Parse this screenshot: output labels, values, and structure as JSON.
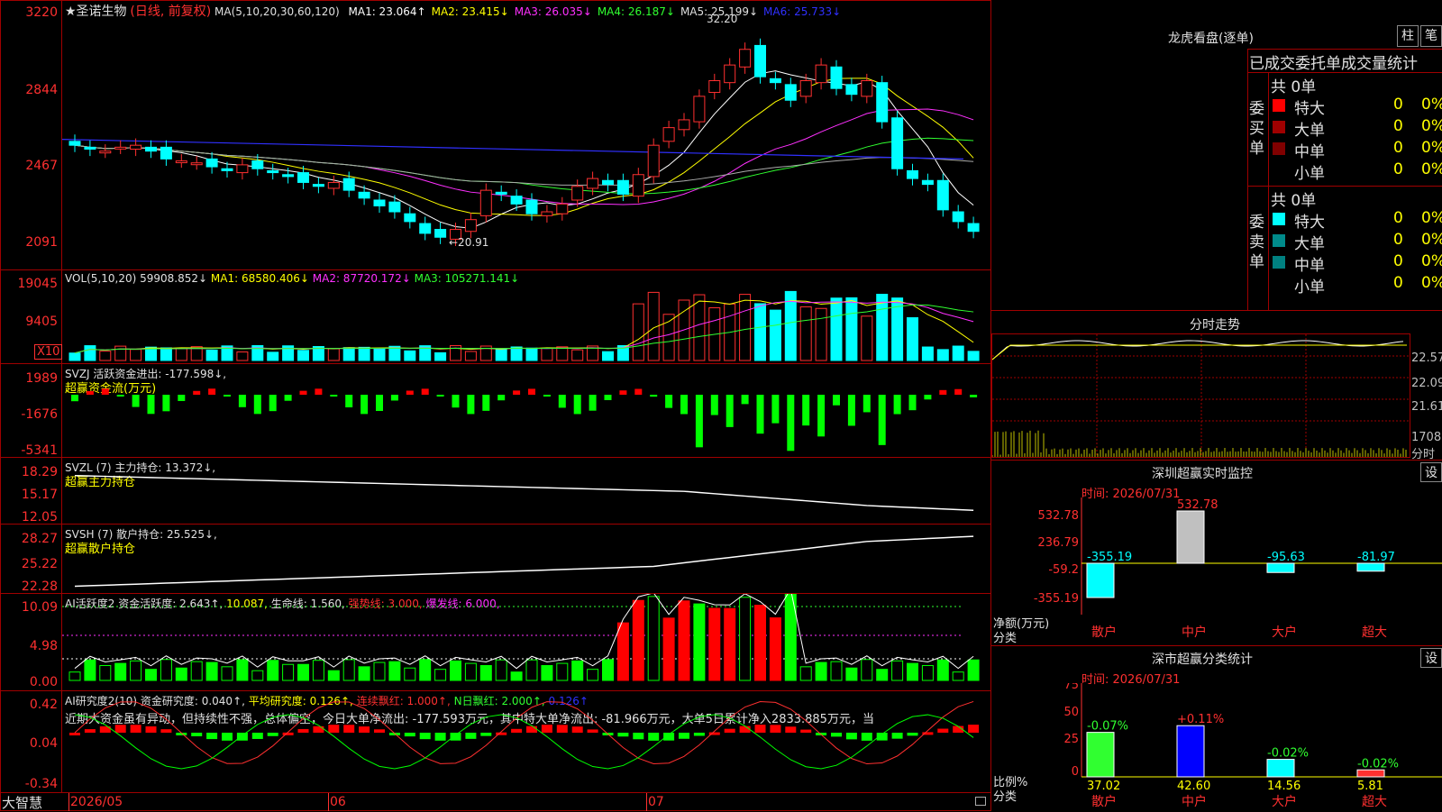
{
  "stock": {
    "name": "★圣诺生物",
    "mode": "(日线, 前复权)",
    "ma_title": "MA(5,10,20,30,60,120)"
  },
  "ma_values": [
    {
      "label": "MA1:",
      "value": "23.064↑",
      "color": "#ffffff"
    },
    {
      "label": "MA2:",
      "value": "23.415↓",
      "color": "#ffff00"
    },
    {
      "label": "MA3:",
      "value": "26.035↓",
      "color": "#ff30ff"
    },
    {
      "label": "MA4:",
      "value": "26.187↓",
      "color": "#30ff30"
    },
    {
      "label": "MA5:",
      "value": "25.199↓",
      "color": "#e0e0e0"
    },
    {
      "label": "MA6:",
      "value": "25.733↓",
      "color": "#3030ff"
    }
  ],
  "price_axis": [
    "3220",
    "2844",
    "2467",
    "2091"
  ],
  "high_marker": "32.20",
  "low_marker": "←20.91",
  "vol": {
    "title": "VOL(5,10,20)",
    "value": "59908.852↓",
    "ma1": "MA1: 68580.406↓",
    "ma2": "MA2: 87720.172↓",
    "ma3": "MA3: 105271.141↓",
    "axis": [
      "19045",
      "9405"
    ],
    "unit": "X10"
  },
  "svzj": {
    "title": "SVZJ",
    "text": "活跃资金进出: -177.598↓,",
    "sub": "超赢资金流(万元)",
    "axis": [
      "1989",
      "-1676",
      "-5341"
    ]
  },
  "svzl": {
    "title": "SVZL",
    "text": "(7) 主力持仓: 13.372↓,",
    "sub": "超赢主力持仓",
    "axis": [
      "18.29",
      "15.17",
      "12.05"
    ]
  },
  "svsh": {
    "title": "SVSH",
    "text": "(7) 散户持仓: 25.525↓,",
    "sub": "超赢散户持仓",
    "axis": [
      "28.27",
      "25.22",
      "22.28"
    ]
  },
  "ai1": {
    "title": "AI活跃度2",
    "text": "资金活跃度: 2.643↑,",
    "v2": "10.087,",
    "v3": "生命线: 1.560,",
    "v4": "强势线: 3.000,",
    "v5": "爆发线: 6.000,",
    "axis": [
      "10.09",
      "4.98",
      "0.00"
    ]
  },
  "ai2": {
    "title": "AI研究度2(10)",
    "text": "资金研究度: 0.040↑,",
    "v2": "平均研究度: 0.126↑,",
    "v3": "连续飘红: 1.000↑,",
    "v4": "N日飘红: 2.000↑,",
    "v5": "0.126↑",
    "axis": [
      "0.42",
      "0.04",
      "-0.34"
    ],
    "comment": "近期大资金虽有异动，但持续性不强，总体偏空，今日大单净流出: -177.593万元，其中特大单净流出: -81.966万元，大单5日累计净入2833.885万元，当"
  },
  "date_axis": [
    "2026/05",
    "06",
    "07"
  ],
  "brand": "大智慧",
  "lhb": {
    "title": "龙虎看盘(逐单)",
    "btn1": "柱",
    "btn2": "笔",
    "header": "已成交委托单成交量统计",
    "buy_label": "委买单",
    "sell_label": "委卖单",
    "buy_count": "共 0单",
    "sell_count": "共 0单",
    "rows": [
      {
        "label": "特大",
        "value": "0",
        "pct": "0%"
      },
      {
        "label": "大单",
        "value": "0",
        "pct": "0%"
      },
      {
        "label": "中单",
        "value": "0",
        "pct": "0%"
      },
      {
        "label": "小单",
        "value": "0",
        "pct": "0%"
      }
    ],
    "buy_colors": [
      "#ff0000",
      "#a00000",
      "#800000",
      "#000000"
    ],
    "sell_colors": [
      "#00ffff",
      "#008b8b",
      "#008080",
      "#000000"
    ]
  },
  "fenshi": {
    "title": "分时走势",
    "axis": [
      "22.57",
      "22.09",
      "21.61"
    ],
    "vol_label": "1708",
    "sub": "分时"
  },
  "sz_monitor": {
    "title": "深圳超赢实时监控",
    "btn": "设",
    "time": "时间: 2026/07/31",
    "axis": [
      "532.78",
      "236.79",
      "-59.2",
      "-355.19"
    ],
    "ylabel": "净额(万元)",
    "xlabel": "分类",
    "bars": [
      {
        "cat": "散户",
        "value": -355.19,
        "label": "-355.19"
      },
      {
        "cat": "中户",
        "value": 532.78,
        "label": "532.78"
      },
      {
        "cat": "大户",
        "value": -95.63,
        "label": "-95.63"
      },
      {
        "cat": "超大",
        "value": -81.97,
        "label": "-81.97"
      }
    ]
  },
  "sz_class": {
    "title": "深市超赢分类统计",
    "btn": "设",
    "time": "时间: 2026/07/31",
    "axis": [
      "75",
      "50",
      "25",
      "0"
    ],
    "ylabel": "比例%",
    "xlabel": "分类",
    "bars": [
      {
        "cat": "散户",
        "value": 37.02,
        "label": "37.02",
        "delta": "-0.07%"
      },
      {
        "cat": "中户",
        "value": 42.6,
        "label": "42.60",
        "delta": "+0.11%"
      },
      {
        "cat": "大户",
        "value": 14.56,
        "label": "14.56",
        "delta": "-0.02%"
      },
      {
        "cat": "超大",
        "value": 5.81,
        "label": "5.81",
        "delta": "-0.02%"
      }
    ]
  },
  "chart_data": {
    "type": "bar",
    "title": "",
    "categories": [
      "散户",
      "中户",
      "大户",
      "超大"
    ],
    "series": [
      {
        "name": "净额(万元)",
        "values": [
          -355.19,
          532.78,
          -95.63,
          -81.97
        ]
      },
      {
        "name": "比例%",
        "values": [
          37.02,
          42.6,
          14.56,
          5.81
        ]
      }
    ],
    "ylim": [
      -355.19,
      532.78
    ]
  }
}
